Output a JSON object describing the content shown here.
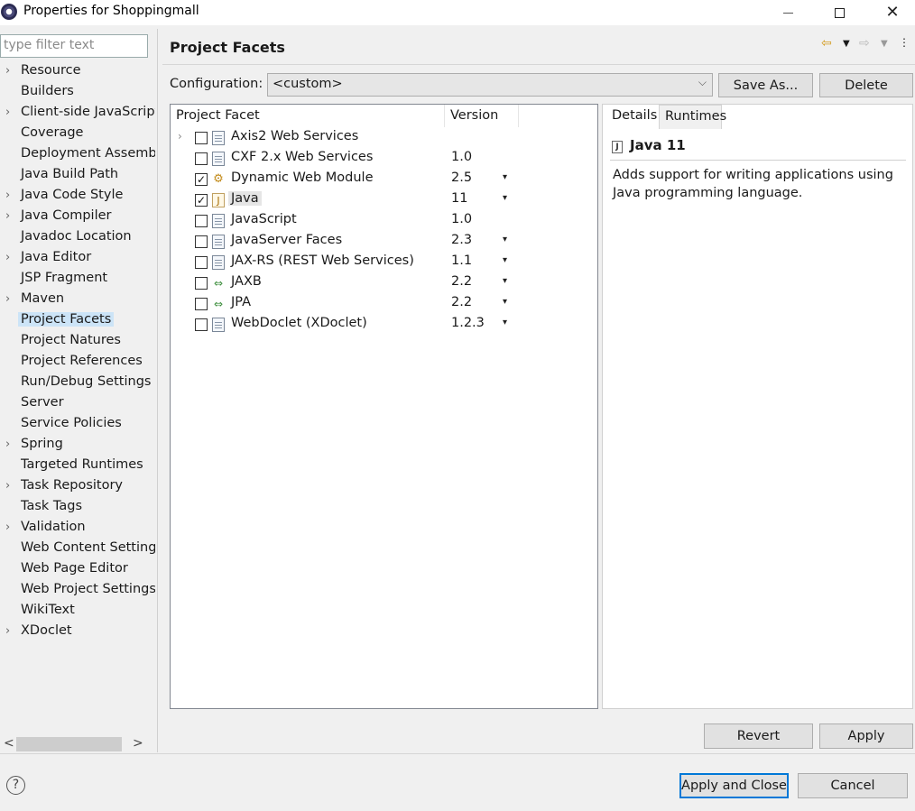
{
  "window": {
    "title": "Properties for Shoppingmall",
    "controls": {
      "minimize": "—",
      "maximize": "☐",
      "close": "✕"
    }
  },
  "filter": {
    "placeholder": "type filter text"
  },
  "nav": {
    "items": [
      {
        "label": "Resource",
        "expandable": true
      },
      {
        "label": "Builders",
        "expandable": false
      },
      {
        "label": "Client-side JavaScript",
        "expandable": true
      },
      {
        "label": "Coverage",
        "expandable": false
      },
      {
        "label": "Deployment Assembly",
        "expandable": false
      },
      {
        "label": "Java Build Path",
        "expandable": false
      },
      {
        "label": "Java Code Style",
        "expandable": true
      },
      {
        "label": "Java Compiler",
        "expandable": true
      },
      {
        "label": "Javadoc Location",
        "expandable": false
      },
      {
        "label": "Java Editor",
        "expandable": true
      },
      {
        "label": "JSP Fragment",
        "expandable": false
      },
      {
        "label": "Maven",
        "expandable": true
      },
      {
        "label": "Project Facets",
        "expandable": false,
        "selected": true
      },
      {
        "label": "Project Natures",
        "expandable": false
      },
      {
        "label": "Project References",
        "expandable": false
      },
      {
        "label": "Run/Debug Settings",
        "expandable": false
      },
      {
        "label": "Server",
        "expandable": false
      },
      {
        "label": "Service Policies",
        "expandable": false
      },
      {
        "label": "Spring",
        "expandable": true
      },
      {
        "label": "Targeted Runtimes",
        "expandable": false
      },
      {
        "label": "Task Repository",
        "expandable": true
      },
      {
        "label": "Task Tags",
        "expandable": false
      },
      {
        "label": "Validation",
        "expandable": true
      },
      {
        "label": "Web Content Settings",
        "expandable": false
      },
      {
        "label": "Web Page Editor",
        "expandable": false
      },
      {
        "label": "Web Project Settings",
        "expandable": false
      },
      {
        "label": "WikiText",
        "expandable": false
      },
      {
        "label": "XDoclet",
        "expandable": true
      }
    ],
    "scroll_left": "<",
    "scroll_right": ">"
  },
  "page": {
    "title": "Project Facets",
    "configuration_label": "Configuration:",
    "configuration_value": "<custom>",
    "save_as": "Save As...",
    "delete": "Delete"
  },
  "facets": {
    "col_facet": "Project Facet",
    "col_version": "Version",
    "rows": [
      {
        "name": "Axis2 Web Services",
        "version": "",
        "checked": false,
        "icon": "doc-icon",
        "expandable": true,
        "dropdown": false
      },
      {
        "name": "CXF 2.x Web Services",
        "version": "1.0",
        "checked": false,
        "icon": "doc-icon",
        "dropdown": false
      },
      {
        "name": "Dynamic Web Module",
        "version": "2.5",
        "checked": true,
        "icon": "gear-icon",
        "dropdown": true
      },
      {
        "name": "Java",
        "version": "11",
        "checked": true,
        "icon": "java-cup-icon",
        "dropdown": true,
        "selected": true
      },
      {
        "name": "JavaScript",
        "version": "1.0",
        "checked": false,
        "icon": "doc-icon",
        "dropdown": false
      },
      {
        "name": "JavaServer Faces",
        "version": "2.3",
        "checked": false,
        "icon": "doc-icon",
        "dropdown": true
      },
      {
        "name": "JAX-RS (REST Web Services)",
        "version": "1.1",
        "checked": false,
        "icon": "doc-icon",
        "dropdown": true
      },
      {
        "name": "JAXB",
        "version": "2.2",
        "checked": false,
        "icon": "arrows-icon",
        "dropdown": true
      },
      {
        "name": "JPA",
        "version": "2.2",
        "checked": false,
        "icon": "arrows-icon",
        "dropdown": true
      },
      {
        "name": "WebDoclet (XDoclet)",
        "version": "1.2.3",
        "checked": false,
        "icon": "doc-icon",
        "dropdown": true
      }
    ]
  },
  "details": {
    "tab_details": "Details",
    "tab_runtimes": "Runtimes",
    "heading": "Java 11",
    "description": "Adds support for writing applications using Java programming language."
  },
  "buttons": {
    "revert": "Revert",
    "apply": "Apply",
    "apply_and_close": "Apply and Close",
    "cancel": "Cancel",
    "help": "?"
  },
  "colors": {
    "selection": "#cce4f7",
    "accent": "#0078d7"
  }
}
